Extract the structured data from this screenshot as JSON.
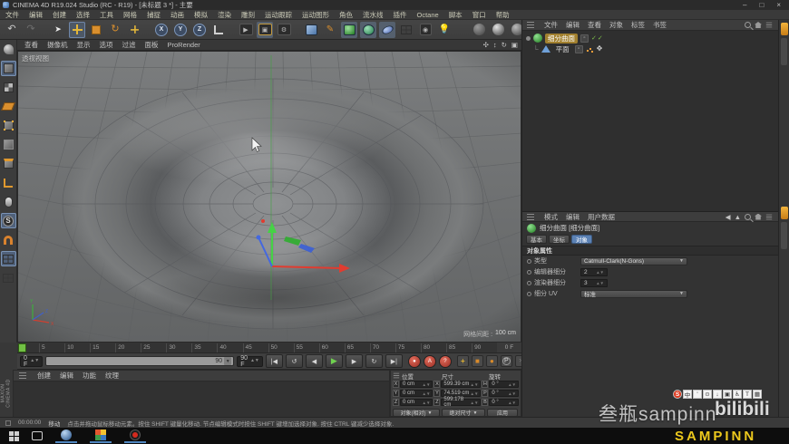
{
  "window": {
    "title": "CINEMA 4D R19.024 Studio (RC - R19) - [未标题 3 *] - 主要",
    "minimize": "–",
    "maximize": "□",
    "close": "×"
  },
  "menu_bar": {
    "items": [
      "文件",
      "编辑",
      "创建",
      "选择",
      "工具",
      "网格",
      "捕捉",
      "动画",
      "模拟",
      "渲染",
      "雕刻",
      "运动跟踪",
      "运动图形",
      "角色",
      "流水线",
      "插件",
      "Octane",
      "脚本",
      "窗口",
      "帮助"
    ]
  },
  "toolbar": {
    "axis_locks": [
      "X",
      "Y",
      "Z"
    ]
  },
  "viewport": {
    "menus": [
      "查看",
      "摄像机",
      "显示",
      "选项",
      "过滤",
      "面板",
      "ProRender"
    ],
    "view_label": "透视视图",
    "grid_label": "网格间距 :",
    "grid_value": "100 cm"
  },
  "object_manager": {
    "menus": [
      "文件",
      "编辑",
      "查看",
      "对象",
      "标签",
      "书签"
    ],
    "objects": [
      {
        "name": "细分曲面"
      },
      {
        "name": "平面"
      }
    ],
    "check_marks": "✓✓"
  },
  "attribute_manager": {
    "menus": [
      "模式",
      "编辑",
      "用户数据"
    ],
    "object_title": "细分曲面 [细分曲面]",
    "tabs": [
      "基本",
      "坐标",
      "对象"
    ],
    "section": "对象属性",
    "fields": {
      "type_label": "类型",
      "type_value": "Catmull-Clark(N-Gons)",
      "editor_sub_label": "编辑器细分",
      "editor_sub_value": "2",
      "render_sub_label": "渲染器细分",
      "render_sub_value": "3",
      "subdiv_uv_label": "细分 UV",
      "subdiv_uv_value": "标准"
    }
  },
  "timeline": {
    "ticks": [
      "5",
      "10",
      "15",
      "20",
      "25",
      "30",
      "35",
      "40",
      "45",
      "50",
      "55",
      "60",
      "65",
      "70",
      "75",
      "80",
      "85",
      "90"
    ],
    "ruler_end": "0 F",
    "current_frame": "0 F",
    "scroll_end": "90",
    "range_end": "90 F"
  },
  "materials": {
    "menus": [
      "创建",
      "编辑",
      "功能",
      "纹理"
    ]
  },
  "coordinates": {
    "title_position": "位置",
    "title_size": "尺寸",
    "title_rotation": "旋转",
    "rows": [
      {
        "axis": "X",
        "pos": "0 cm",
        "size_axis": "X",
        "size": "599.39 cm",
        "rot_axis": "H",
        "rot": "0 °"
      },
      {
        "axis": "Y",
        "pos": "0 cm",
        "size_axis": "Y",
        "size": "74.519 cm",
        "rot_axis": "P",
        "rot": "0 °"
      },
      {
        "axis": "Z",
        "pos": "0 cm",
        "size_axis": "Z",
        "size": "599.178 cm",
        "rot_axis": "B",
        "rot": "0 °"
      }
    ],
    "mode_object": "对象(相对)",
    "mode_size": "绝对尺寸",
    "apply": "应用"
  },
  "status_bar": {
    "time": "00:00:00",
    "tool": "移动",
    "hint": "点击并拖动鼠标移动元素。按住 SHIFT 键量化移动. 节点编辑模式时按住 SHIFT 键增加选择对象. 按住 CTRL 键减少选择对象."
  },
  "branding": {
    "maxon": "MAXON",
    "cinema": "CINEMA 4D",
    "watermark_cn": "叁瓶sampinn",
    "bilibili": "bilibili",
    "sampinn": "SAMPINN",
    "ime": [
      "S",
      "中",
      "'",
      "⊙",
      "↓",
      "▣",
      "♿",
      "T",
      "▦"
    ]
  },
  "colors": {
    "accent_orange": "#d9a027",
    "axis_red": "#d84040",
    "axis_green": "#3fbf3f",
    "axis_blue": "#4060d8",
    "select_blue": "#5c82b5",
    "play_green": "#6fd14f",
    "record_red": "#c03a30",
    "sampinn_yellow": "#ecc81d",
    "viewport_gray": "#6f7173"
  }
}
